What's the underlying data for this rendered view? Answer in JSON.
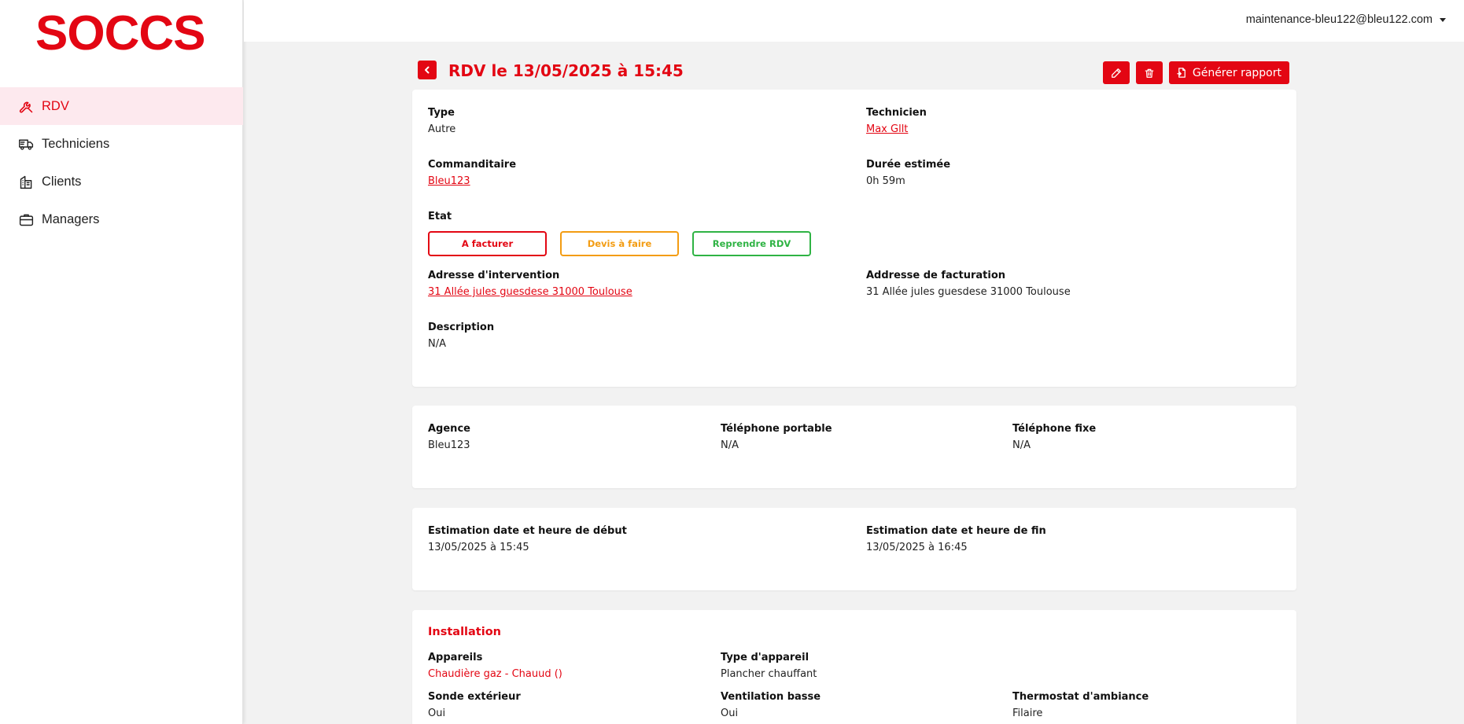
{
  "brand": {
    "logo": "SOCCS",
    "accent": "#e30613"
  },
  "sidebar": {
    "items": [
      {
        "label": "RDV",
        "icon": "wrench-icon",
        "active": true
      },
      {
        "label": "Techniciens",
        "icon": "truck-icon",
        "active": false
      },
      {
        "label": "Clients",
        "icon": "building-icon",
        "active": false
      },
      {
        "label": "Managers",
        "icon": "briefcase-icon",
        "active": false
      }
    ]
  },
  "header": {
    "user_email": "maintenance-bleu122@bleu122.com"
  },
  "page": {
    "title": "RDV le 13/05/2025 à 15:45",
    "actions": {
      "edit": "pencil-icon",
      "delete": "trash-icon",
      "report_label": "Générer rapport"
    }
  },
  "details": {
    "type_label": "Type",
    "type_value": "Autre",
    "technicien_label": "Technicien",
    "technicien_value": "Max Gllt",
    "commanditaire_label": "Commanditaire",
    "commanditaire_value": "Bleu123",
    "duree_label": "Durée estimée",
    "duree_value": "0h 59m",
    "etat_label": "Etat",
    "etat_buttons": [
      "A facturer",
      "Devis à faire",
      "Reprendre RDV"
    ],
    "adresse_intervention_label": "Adresse d'intervention",
    "adresse_intervention_value": "31 Allée jules guesdese 31000 Toulouse",
    "adresse_facturation_label": "Addresse de facturation",
    "adresse_facturation_value": "31 Allée jules guesdese 31000 Toulouse",
    "description_label": "Description",
    "description_value": "N/A"
  },
  "agence": {
    "agence_label": "Agence",
    "agence_value": "Bleu123",
    "portable_label": "Téléphone portable",
    "portable_value": "N/A",
    "fixe_label": "Téléphone fixe",
    "fixe_value": "N/A"
  },
  "estimation": {
    "debut_label": "Estimation date et heure de début",
    "debut_value": "13/05/2025 à 15:45",
    "fin_label": "Estimation date et heure de fin",
    "fin_value": "13/05/2025 à 16:45"
  },
  "installation": {
    "title": "Installation",
    "appareils_label": "Appareils",
    "appareils_value": "Chaudière gaz - Chauud ()",
    "type_appareil_label": "Type d'appareil",
    "type_appareil_value": "Plancher chauffant",
    "sonde_label": "Sonde extérieur",
    "sonde_value": "Oui",
    "ventilation_label": "Ventilation basse",
    "ventilation_value": "Oui",
    "thermostat_label": "Thermostat d'ambiance",
    "thermostat_value": "Filaire"
  }
}
